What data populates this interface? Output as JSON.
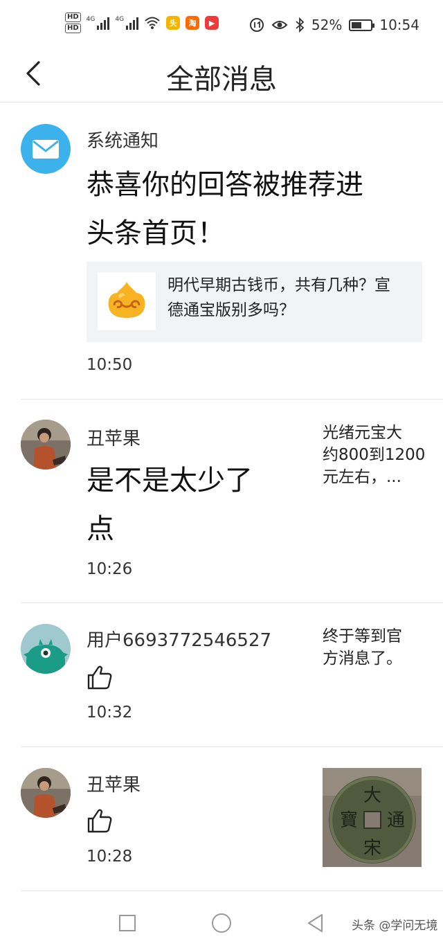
{
  "status_bar": {
    "hd1": "HD",
    "hd2": "HD",
    "net1": "4G",
    "net2": "4G",
    "app1_label": "头",
    "app2_label": "淘",
    "app3_label": "▶",
    "battery_percent": "52%",
    "battery_level": 0.52,
    "time": "10:54"
  },
  "header": {
    "title": "全部消息"
  },
  "messages": [
    {
      "name": "系统通知",
      "content_line1": "恭喜你的回答被推荐进",
      "content_line2": "头条首页！",
      "card_text": "明代早期古钱币，共有几种？宣德通宝版别多吗？",
      "time": "10:50"
    },
    {
      "name": "丑苹果",
      "content_line1": "是不是太少了",
      "content_line2": "点",
      "side_line1": "光绪元宝大",
      "side_line2": "约800到1200",
      "side_line3": "元左右，...",
      "time": "10:26"
    },
    {
      "name": "用户6693772546527",
      "side_line1": "终于等到官",
      "side_line2": "方消息了。",
      "time": "10:32"
    },
    {
      "name": "丑苹果",
      "time": "10:28",
      "coin_chars": [
        "大",
        "通",
        "宋",
        "寶"
      ]
    }
  ],
  "watermark": "头条 @学问无境",
  "icons": {
    "back": "back-arrow-icon",
    "mail": "mail-icon",
    "like": "thumbs-up-icon"
  },
  "colors": {
    "mail_avatar": "#3cb2ec",
    "monster_avatar": "#9fc9cf",
    "monster": "#1b9c89",
    "card_bg": "#f2f3f5"
  }
}
